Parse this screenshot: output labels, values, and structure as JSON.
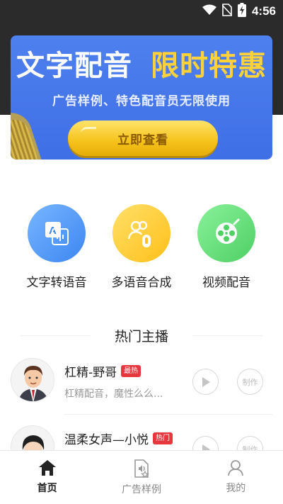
{
  "status_bar": {
    "time": "4:56"
  },
  "banner": {
    "title_white": "文字配音",
    "title_yellow": "限时特惠",
    "subtitle": "广告样例、特色配音员无限使用",
    "button_label": "立即查看"
  },
  "features": [
    {
      "label": "文字转语音",
      "icon": "text-to-speech-icon"
    },
    {
      "label": "多语音合成",
      "icon": "multi-voice-icon"
    },
    {
      "label": "视频配音",
      "icon": "video-dubbing-icon"
    }
  ],
  "hot_section": {
    "title": "热门主播"
  },
  "anchors": [
    {
      "name": "杠精-野哥",
      "badge": "最热",
      "desc": "杠精配音，魔性么么...",
      "make_label": "制作"
    },
    {
      "name": "温柔女声—小悦",
      "badge": "热门",
      "desc": "",
      "make_label": "制作"
    }
  ],
  "tabbar": {
    "items": [
      {
        "label": "首页",
        "icon": "home-icon",
        "active": true
      },
      {
        "label": "广告样例",
        "icon": "ad-sample-icon",
        "active": false
      },
      {
        "label": "我的",
        "icon": "user-icon",
        "active": false
      }
    ]
  },
  "colors": {
    "banner_bg": "#4e80ee",
    "banner_accent": "#ffd23a",
    "badge_red": "#e8363e",
    "header_dark": "#2b2b2b"
  }
}
